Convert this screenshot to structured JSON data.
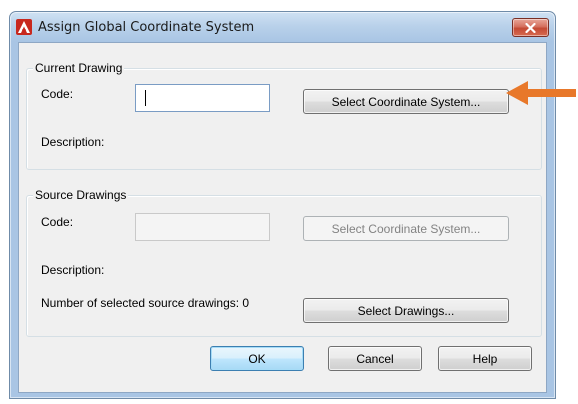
{
  "window": {
    "title": "Assign Global Coordinate System"
  },
  "current_drawing": {
    "group_label": "Current Drawing",
    "code_label": "Code:",
    "code_value": "",
    "select_cs_button": "Select Coordinate System...",
    "description_label": "Description:"
  },
  "source_drawings": {
    "group_label": "Source Drawings",
    "code_label": "Code:",
    "code_value": "",
    "select_cs_button": "Select Coordinate System...",
    "description_label": "Description:",
    "count_label": "Number of selected source drawings: 0",
    "select_drawings_button": "Select Drawings..."
  },
  "buttons": {
    "ok": "OK",
    "cancel": "Cancel",
    "help": "Help"
  },
  "colors": {
    "title_bar": "#a9c5e4",
    "close_button": "#c44a34",
    "annotation_arrow": "#e8782a",
    "app_icon": "#c8281e"
  },
  "icons": {
    "app": "autocad-logo-icon",
    "close": "close-icon",
    "annotation": "arrow-left-icon"
  }
}
